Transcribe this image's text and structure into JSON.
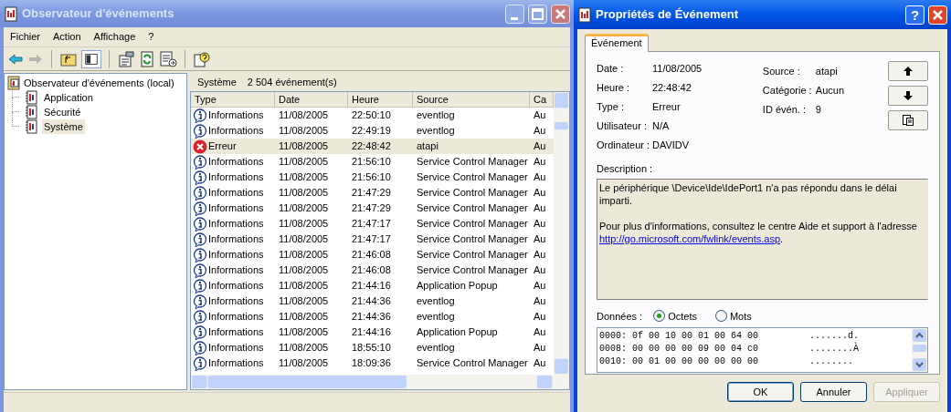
{
  "main_window": {
    "title": "Observateur d'événements",
    "active": false,
    "menu": [
      "Fichier",
      "Action",
      "Affichage",
      "?"
    ],
    "tree": {
      "label": "Observateur d'événements (local)",
      "children": [
        {
          "label": "Application",
          "selected": false
        },
        {
          "label": "Sécurité",
          "selected": false
        },
        {
          "label": "Système",
          "selected": true
        }
      ]
    },
    "list_header": {
      "log": "Système",
      "count": "2 504 événement(s)"
    },
    "table": {
      "columns": [
        "Type",
        "Date",
        "Heure",
        "Source",
        "Ca"
      ],
      "rows": [
        {
          "kind": "info",
          "selected": false,
          "cells": [
            "Informations",
            "11/08/2005",
            "22:50:10",
            "eventlog",
            "Au"
          ]
        },
        {
          "kind": "info",
          "selected": false,
          "cells": [
            "Informations",
            "11/08/2005",
            "22:49:19",
            "eventlog",
            "Au"
          ]
        },
        {
          "kind": "error",
          "selected": true,
          "cells": [
            "Erreur",
            "11/08/2005",
            "22:48:42",
            "atapi",
            "Au"
          ]
        },
        {
          "kind": "info",
          "selected": false,
          "cells": [
            "Informations",
            "11/08/2005",
            "21:56:10",
            "Service Control Manager",
            "Au"
          ]
        },
        {
          "kind": "info",
          "selected": false,
          "cells": [
            "Informations",
            "11/08/2005",
            "21:56:10",
            "Service Control Manager",
            "Au"
          ]
        },
        {
          "kind": "info",
          "selected": false,
          "cells": [
            "Informations",
            "11/08/2005",
            "21:47:29",
            "Service Control Manager",
            "Au"
          ]
        },
        {
          "kind": "info",
          "selected": false,
          "cells": [
            "Informations",
            "11/08/2005",
            "21:47:29",
            "Service Control Manager",
            "Au"
          ]
        },
        {
          "kind": "info",
          "selected": false,
          "cells": [
            "Informations",
            "11/08/2005",
            "21:47:17",
            "Service Control Manager",
            "Au"
          ]
        },
        {
          "kind": "info",
          "selected": false,
          "cells": [
            "Informations",
            "11/08/2005",
            "21:47:17",
            "Service Control Manager",
            "Au"
          ]
        },
        {
          "kind": "info",
          "selected": false,
          "cells": [
            "Informations",
            "11/08/2005",
            "21:46:08",
            "Service Control Manager",
            "Au"
          ]
        },
        {
          "kind": "info",
          "selected": false,
          "cells": [
            "Informations",
            "11/08/2005",
            "21:46:08",
            "Service Control Manager",
            "Au"
          ]
        },
        {
          "kind": "info",
          "selected": false,
          "cells": [
            "Informations",
            "11/08/2005",
            "21:44:16",
            "Application Popup",
            "Au"
          ]
        },
        {
          "kind": "info",
          "selected": false,
          "cells": [
            "Informations",
            "11/08/2005",
            "21:44:36",
            "eventlog",
            "Au"
          ]
        },
        {
          "kind": "info",
          "selected": false,
          "cells": [
            "Informations",
            "11/08/2005",
            "21:44:36",
            "eventlog",
            "Au"
          ]
        },
        {
          "kind": "info",
          "selected": false,
          "cells": [
            "Informations",
            "11/08/2005",
            "21:44:16",
            "Application Popup",
            "Au"
          ]
        },
        {
          "kind": "info",
          "selected": false,
          "cells": [
            "Informations",
            "11/08/2005",
            "18:55:10",
            "eventlog",
            "Au"
          ]
        },
        {
          "kind": "info",
          "selected": false,
          "cells": [
            "Informations",
            "11/08/2005",
            "18:09:36",
            "Service Control Manager",
            "Au"
          ]
        }
      ]
    }
  },
  "dialog": {
    "title": "Propriétés de Événement",
    "active": true,
    "help_button": "?",
    "tabs": [
      {
        "label": "Événement",
        "selected": true
      }
    ],
    "fields_left": [
      {
        "label": "Date :",
        "value": "11/08/2005"
      },
      {
        "label": "Heure :",
        "value": "22:48:42"
      },
      {
        "label": "Type :",
        "value": "Erreur"
      },
      {
        "label": "Utilisateur :",
        "value": "N/A"
      },
      {
        "label": "Ordinateur :",
        "value": "DAVIDV"
      }
    ],
    "fields_right": [
      {
        "label": "Source :",
        "value": "atapi"
      },
      {
        "label": "Catégorie :",
        "value": "Aucun"
      },
      {
        "label": "ID évén. :",
        "value": "9"
      }
    ],
    "description_label": "Description :",
    "description": {
      "paragraph_1": "Le périphérique \\Device\\Ide\\IdePort1 n'a pas répondu dans le délai imparti.",
      "paragraph_2": "Pour plus d'informations, consultez le centre Aide et support à l'adresse",
      "link": "http://go.microsoft.com/fwlink/events.asp",
      "after_link": "."
    },
    "data_label": "Données :",
    "radios": [
      {
        "label": "Octets",
        "selected": true
      },
      {
        "label": "Mots",
        "selected": false
      }
    ],
    "hex_lines": [
      {
        "bytes": "0000: 0f 00 10 00 01 00 64 00",
        "chars": ".......d."
      },
      {
        "bytes": "0008: 00 00 00 00 09 00 04 c0",
        "chars": "........À"
      },
      {
        "bytes": "0010: 00 01 00 00 00 00 00 00",
        "chars": "........"
      }
    ],
    "buttons": [
      {
        "label": "OK",
        "disabled": false,
        "default": true
      },
      {
        "label": "Annuler",
        "disabled": false,
        "default": false
      },
      {
        "label": "Appliquer",
        "disabled": true,
        "default": false
      }
    ]
  }
}
